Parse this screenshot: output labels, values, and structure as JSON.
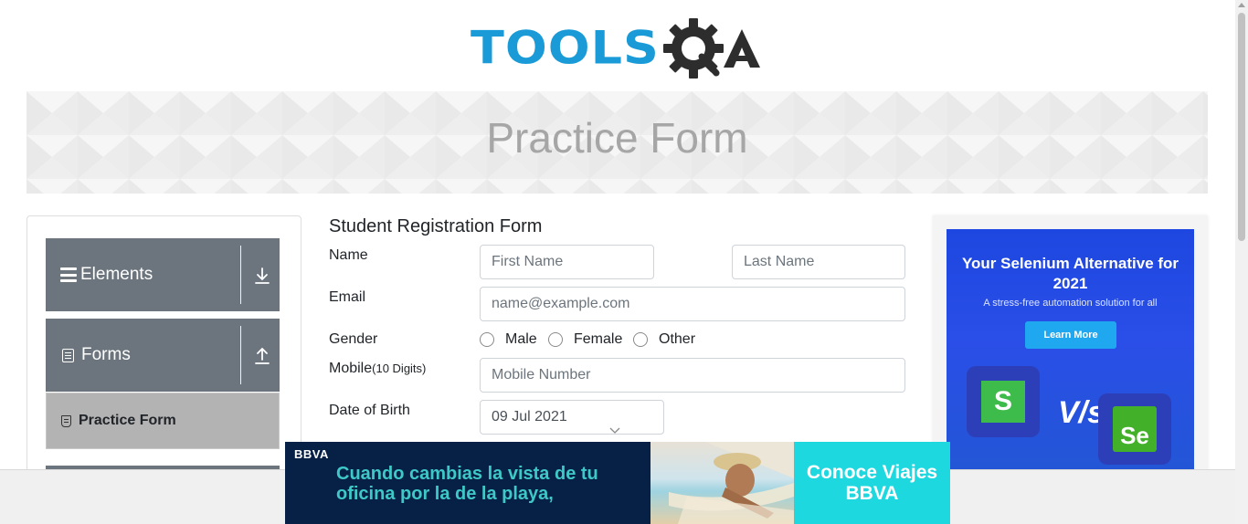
{
  "header": {
    "logo_text": "TOOLS",
    "logo_suffix": "QA"
  },
  "banner": {
    "title": "Practice Form"
  },
  "sidebar": {
    "groups": [
      {
        "label": "Elements",
        "icon": "hamburger-icon",
        "arrow": "download-arrow-icon"
      },
      {
        "label": "Forms",
        "icon": "form-icon",
        "arrow": "upload-arrow-icon"
      }
    ],
    "active_item": {
      "label": "Practice Form",
      "icon": "form-small-icon"
    }
  },
  "form": {
    "title": "Student Registration Form",
    "name_label": "Name",
    "first_name_placeholder": "First Name",
    "last_name_placeholder": "Last Name",
    "email_label": "Email",
    "email_placeholder": "name@example.com",
    "gender_label": "Gender",
    "gender_options": [
      "Male",
      "Female",
      "Other"
    ],
    "mobile_label": "Mobile",
    "mobile_hint": "(10 Digits)",
    "mobile_placeholder": "Mobile Number",
    "dob_label": "Date of Birth",
    "dob_value": "09 Jul 2021"
  },
  "right_ad": {
    "title": "Your Selenium Alternative for 2021",
    "subtitle": "A stress-free automation solution for all",
    "button": "Learn More",
    "left_logo": "S",
    "vs": "V/s",
    "right_logo": "Se"
  },
  "bottom_ad": {
    "brand": "BBVA",
    "headline": "Cuando cambias la vista de tu oficina por la de la playa,",
    "cta": "Conoce Viajes BBVA"
  },
  "colors": {
    "accent": "#1a9bd7",
    "sidebar_group": "#6c757d",
    "active_item": "#b3b3b3",
    "ad_blue": "#1d47e0",
    "bbva_navy": "#072146",
    "bbva_teal": "#1ed8e0"
  }
}
